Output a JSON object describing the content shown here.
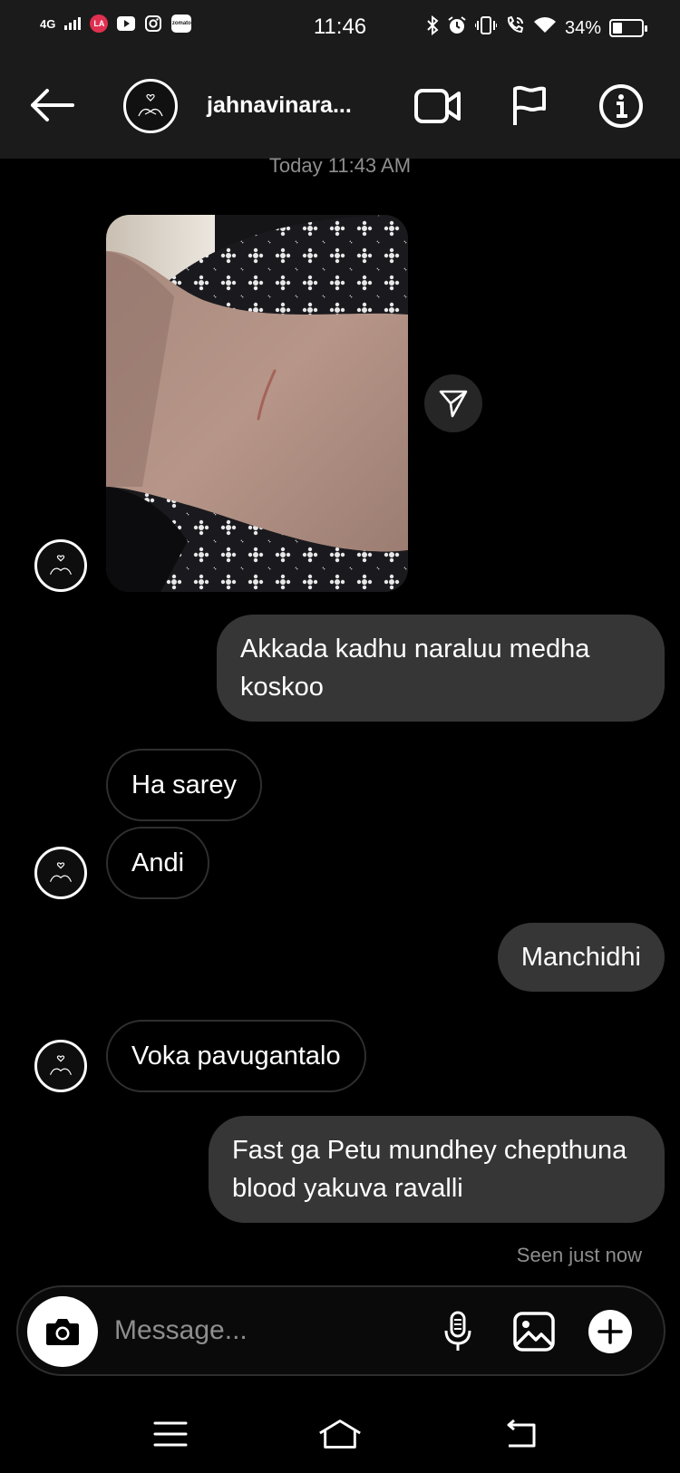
{
  "status_bar": {
    "network": "4G",
    "time": "11:46",
    "battery": "34%",
    "notification_icons": [
      "lens-app-icon",
      "youtube-icon",
      "instagram-icon",
      "zomato-icon"
    ],
    "zomato_label": "zomato",
    "lens_label": "LA"
  },
  "header": {
    "username": "jahnavinara..."
  },
  "conversation": {
    "timestamp": "Today 11:43 AM",
    "messages": [
      {
        "sender": "other",
        "type": "image"
      },
      {
        "sender": "me",
        "text": "Akkada kadhu naraluu medha koskoo"
      },
      {
        "sender": "other",
        "text": "Ha sarey"
      },
      {
        "sender": "other",
        "text": "Andi"
      },
      {
        "sender": "me",
        "text": "Manchidhi"
      },
      {
        "sender": "other",
        "text": "Voka pavugantalo"
      },
      {
        "sender": "me",
        "text": "Fast ga Petu mundhey chepthuna blood yakuva ravalli"
      }
    ],
    "seen": "Seen just now"
  },
  "composer": {
    "placeholder": "Message..."
  },
  "colors": {
    "background": "#000000",
    "bar": "#1b1b1b",
    "outgoing_bubble": "#363636",
    "muted_text": "#8e8e8e"
  }
}
